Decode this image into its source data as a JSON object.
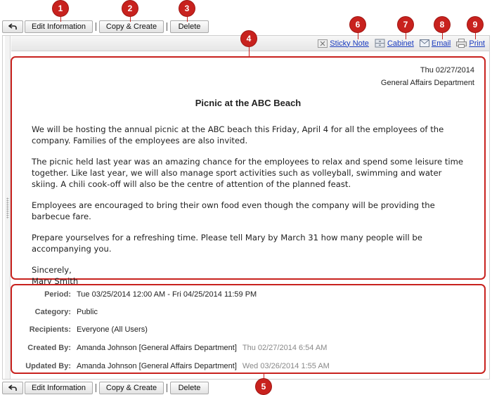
{
  "toolbar": {
    "back_label": "↰",
    "edit_label": "Edit Information",
    "copy_label": "Copy & Create",
    "delete_label": "Delete"
  },
  "markers": [
    "1",
    "2",
    "3",
    "4",
    "5",
    "6",
    "7",
    "8",
    "9"
  ],
  "actions": {
    "sticky_note": "Sticky Note",
    "cabinet": "Cabinet",
    "email": "Email",
    "print": "Print"
  },
  "message": {
    "date": "Thu 02/27/2014",
    "department": "General Affairs Department",
    "title": "Picnic at the ABC Beach",
    "paragraphs": [
      "We will be hosting the annual picnic at the ABC beach this Friday, April 4 for all the employees of the company. Families of the employees are also invited.",
      "The picnic held last year was an amazing chance for the employees to relax and spend some leisure time together. Like last year, we will also manage sport activities such as volleyball, swimming and water skiing. A chili cook-off will also be the centre of attention of the planned feast.",
      "Employees are encouraged to bring their own food even though the company will be providing the barbecue fare.",
      "Prepare yourselves for a refreshing time. Please tell Mary by March 31 how many people will be accompanying you."
    ],
    "closing": "Sincerely,",
    "signature": "Mary Smith"
  },
  "details": {
    "period_label": "Period:",
    "period_value": "Tue 03/25/2014 12:00 AM - Fri 04/25/2014 11:59 PM",
    "category_label": "Category:",
    "category_value": "Public",
    "recipients_label": "Recipients:",
    "recipients_value": "Everyone (All Users)",
    "created_label": "Created By:",
    "created_value": "Amanda Johnson [General Affairs Department]",
    "created_ts": "Thu 02/27/2014 6:54 AM",
    "updated_label": "Updated By:",
    "updated_value": "Amanda Johnson [General Affairs Department]",
    "updated_ts": "Wed 03/26/2014 1:55 AM"
  },
  "colors": {
    "accent": "#c8221e",
    "link": "#1a3bbf"
  }
}
